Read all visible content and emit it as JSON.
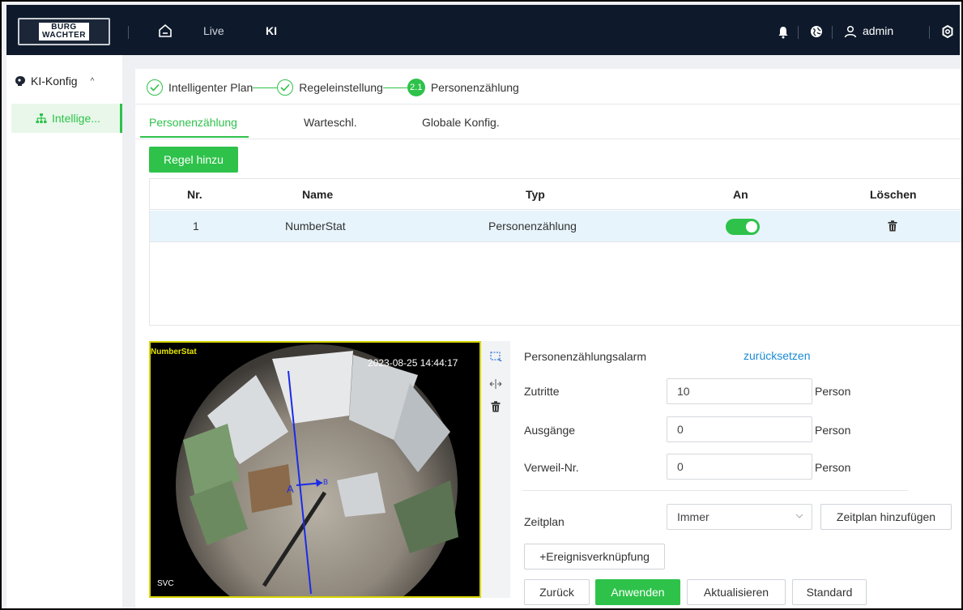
{
  "header": {
    "logo_line1": "BURG",
    "logo_line2": "WACHTER",
    "nav": [
      {
        "label": "Live"
      },
      {
        "label": "KI"
      }
    ],
    "username": "admin",
    "icons": [
      "home-icon",
      "bell-icon",
      "globe-icon",
      "user-icon",
      "gear-icon"
    ]
  },
  "sidebar": {
    "group_label": "KI-Konfig",
    "group_caret": "^",
    "items": [
      {
        "label": "Intellige...",
        "icon": "network-icon",
        "active": true
      }
    ]
  },
  "steps": [
    {
      "label": "Intelligenter Plan",
      "state": "done"
    },
    {
      "label": "Regeleinstellung",
      "state": "done"
    },
    {
      "badge": "2.1",
      "label": "Personenzählung",
      "state": "active"
    }
  ],
  "tabs": [
    {
      "label": "Personenzählung",
      "active": true
    },
    {
      "label": "Warteschl.",
      "active": false
    },
    {
      "label": "Globale Konfig.",
      "active": false
    }
  ],
  "add_rule_button": "Regel hinzu",
  "table": {
    "headers": [
      "Nr.",
      "Name",
      "Typ",
      "An",
      "Löschen"
    ],
    "rows": [
      {
        "nr": "1",
        "name": "NumberStat",
        "typ": "Personenzählung",
        "enabled": true
      }
    ]
  },
  "video": {
    "rule_label": "NumberStat",
    "timestamp": "2023-08-25 14:44:17",
    "corner_text": "SVC",
    "line_label_a": "A",
    "line_label_b": "B"
  },
  "tools": [
    "draw-rule-icon",
    "split-arrows-icon",
    "trash-icon"
  ],
  "form": {
    "alarm_label": "Personenzählungsalarm",
    "reset_link": "zurücksetzen",
    "fields": [
      {
        "label": "Zutritte",
        "value": "10",
        "unit": "Person"
      },
      {
        "label": "Ausgänge",
        "value": "0",
        "unit": "Person"
      },
      {
        "label": "Verweil-Nr.",
        "value": "0",
        "unit": "Person"
      }
    ],
    "schedule_label": "Zeitplan",
    "schedule_value": "Immer",
    "add_schedule_button": "Zeitplan hinzufügen",
    "event_link_button": "+Ereignisverknüpfung",
    "buttons": {
      "back": "Zurück",
      "apply": "Anwenden",
      "refresh": "Aktualisieren",
      "default": "Standard"
    }
  },
  "colors": {
    "accent": "#2ec24a",
    "topbar": "#0e1a2b",
    "link": "#1a8ad6",
    "row_highlight": "#e7f4fb",
    "video_border": "#d8d400"
  }
}
